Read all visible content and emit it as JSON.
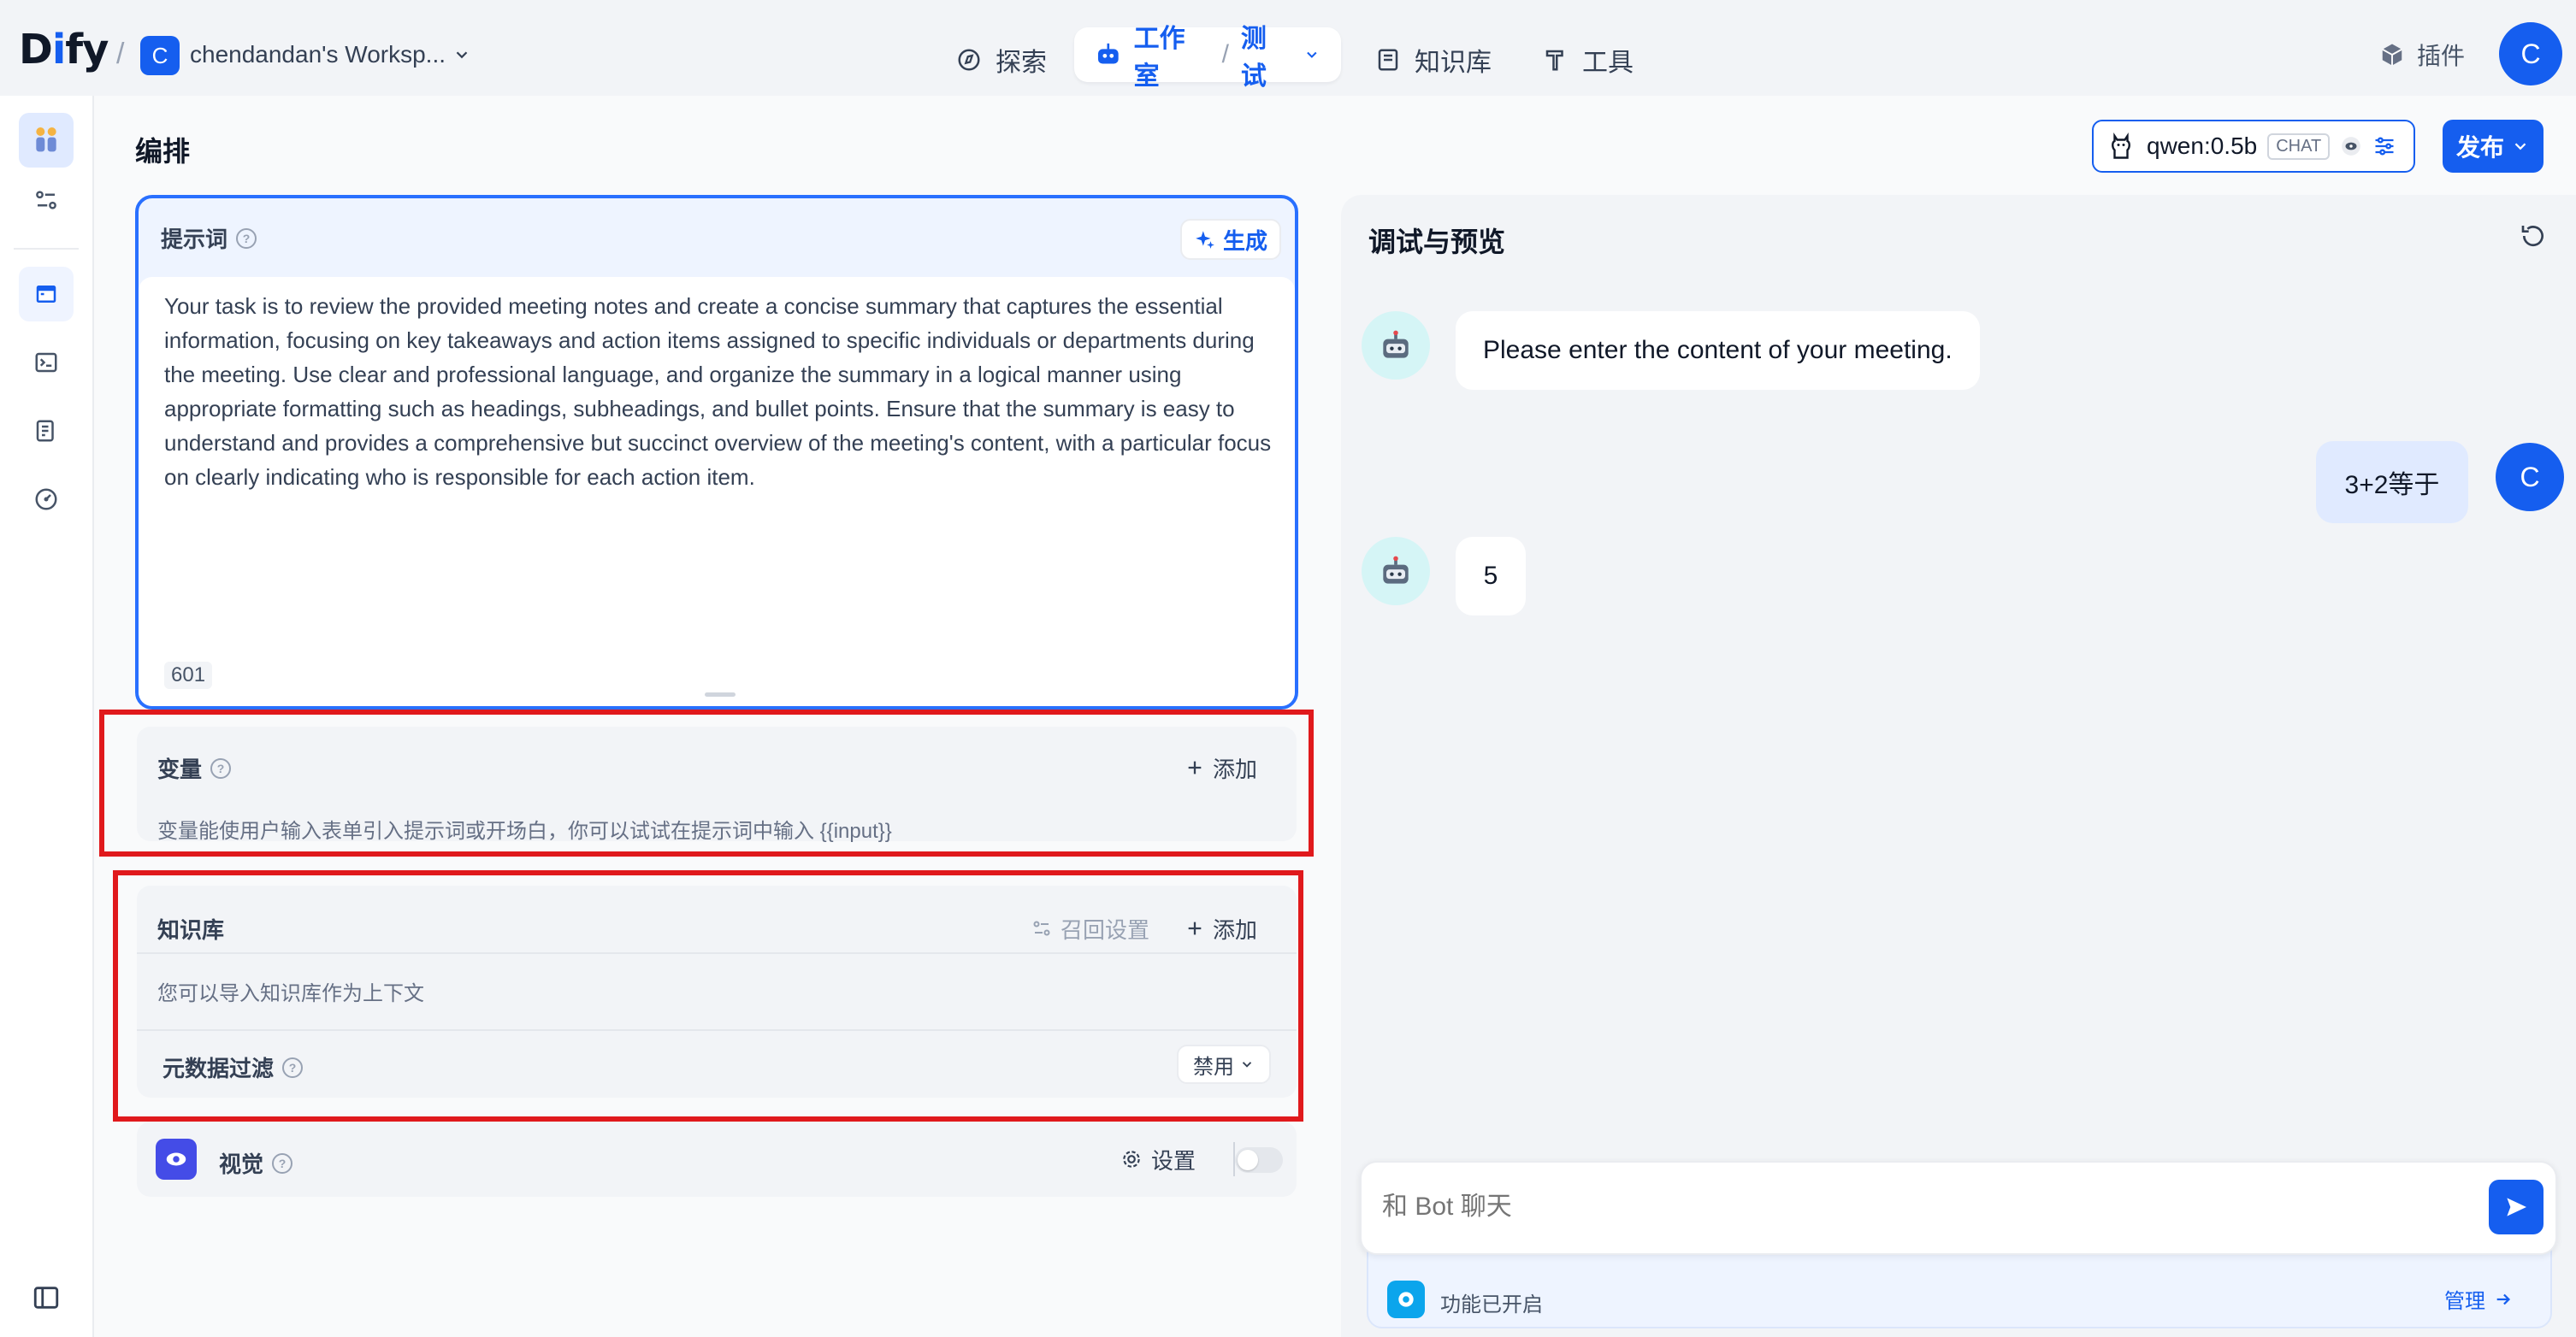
{
  "header": {
    "logo": "Dify",
    "workspace_initial": "C",
    "workspace_name": "chendandan's Worksp...",
    "nav_explore": "探索",
    "nav_studio": "工作室",
    "nav_studio_sub": "测试",
    "nav_knowledge": "知识库",
    "nav_tools": "工具",
    "plugins": "插件",
    "user_initial": "C"
  },
  "orchestrate": {
    "title": "编排",
    "model_name": "qwen:0.5b",
    "model_badge": "CHAT",
    "publish": "发布"
  },
  "prompt": {
    "title": "提示词",
    "generate": "生成",
    "text": "Your task is to review the provided meeting notes and create a concise summary that captures the essential information, focusing on key takeaways and action items assigned to specific individuals or departments during the meeting. Use clear and professional language, and organize the summary in a logical manner using appropriate formatting such as headings, subheadings, and bullet points. Ensure that the summary is easy to understand and provides a comprehensive but succinct overview of the meeting's content, with a particular focus on clearly indicating who is responsible for each action item.",
    "char_count": "601"
  },
  "variables": {
    "title": "变量",
    "add": "添加",
    "hint": "变量能使用户输入表单引入提示词或开场白，你可以试试在提示词中输入 {{input}}"
  },
  "knowledge": {
    "title": "知识库",
    "recall_settings": "召回设置",
    "add": "添加",
    "hint": "您可以导入知识库作为上下文",
    "metadata_filter": "元数据过滤",
    "metadata_value": "禁用"
  },
  "vision": {
    "title": "视觉",
    "settings": "设置",
    "enabled": false
  },
  "debug": {
    "title": "调试与预览",
    "messages": [
      {
        "role": "bot",
        "text": "Please enter the content of your meeting."
      },
      {
        "role": "user",
        "text": "3+2等于"
      },
      {
        "role": "bot",
        "text": "5"
      }
    ],
    "user_initial": "C",
    "input_placeholder": "和 Bot 聊天",
    "features_enabled": "功能已开启",
    "manage": "管理"
  },
  "colors": {
    "accent": "#155eef",
    "highlight_box": "#e0191c",
    "page_bg": "#f2f4f7"
  }
}
